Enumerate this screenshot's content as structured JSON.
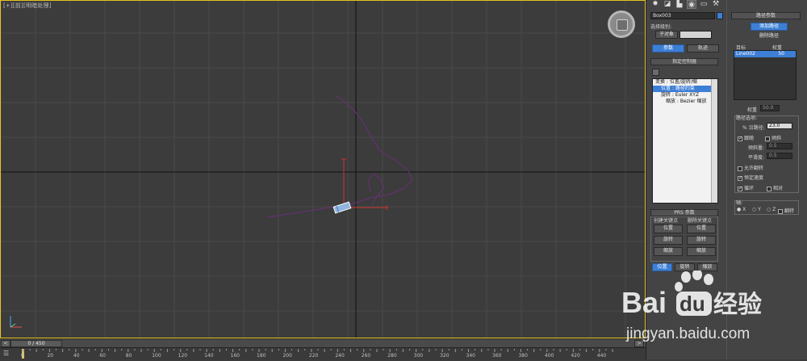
{
  "viewport": {
    "label": "[+][前][明暗处理]",
    "accent_color": "#e8c220"
  },
  "timeline": {
    "slider_text": "0 / 450",
    "prev_icon": "<",
    "next_icon": ">",
    "ruler_labels": [
      "0",
      "20",
      "40",
      "60",
      "80",
      "100",
      "120",
      "140",
      "160",
      "180",
      "200",
      "220",
      "240",
      "260",
      "280",
      "300",
      "320",
      "340",
      "360",
      "380",
      "400",
      "420",
      "440"
    ]
  },
  "left_panel": {
    "tabs": [
      "create-icon",
      "modify-icon",
      "hierarchy-icon",
      "motion-icon",
      "display-icon",
      "utilities-icon"
    ],
    "object_name": "Box003",
    "select_level_label": "选择级别:",
    "sub_object_button": "子对象",
    "params_button": "参数",
    "trajectory_button": "轨迹",
    "assign_controller_title": "指定控制器",
    "tree": [
      {
        "label": "变换 : 位置/旋转/缩",
        "selected": false
      },
      {
        "label": "位置 : 路径约束",
        "selected": true
      },
      {
        "label": "旋转 : Euler XYZ",
        "selected": false
      },
      {
        "label": "缩放 : Bezier 缩放",
        "selected": false
      }
    ],
    "prs_title": "PRS 参数",
    "create_key_label": "创建关键点",
    "delete_key_label": "删除关键点",
    "create_keys": [
      "位置",
      "旋转",
      "缩放"
    ],
    "delete_keys": [
      "位置",
      "旋转",
      "缩放"
    ],
    "bottom_tabs": [
      "位置",
      "旋转",
      "缩放"
    ]
  },
  "right_panel": {
    "path_params_title": "路径参数",
    "add_path_button": "添加路径",
    "delete_path_button": "删除路径",
    "target_label": "目标",
    "weight_label": "权重",
    "list_rows": [
      {
        "target": "Line002",
        "weight": "50"
      }
    ],
    "weight_field_label": "权重",
    "weight_field_value": "50.0",
    "path_options_label": "路径选项:",
    "percent_label": "% 沿路径:",
    "percent_value": "23.0",
    "follow_label": "跟随",
    "bank_label": "倾斜",
    "bank_amount_label": "倾斜量:",
    "bank_amount_value": "0.5",
    "smooth_label": "平滑度:",
    "smooth_value": "0.5",
    "allow_flip_label": "允许翻转",
    "constant_velocity_label": "恒定速度",
    "loop_label": "循环",
    "relative_label": "相对",
    "axis_label": "轴:",
    "axis_x": "X",
    "axis_y": "Y",
    "axis_z": "Z",
    "flip_label": "翻转"
  },
  "watermark": {
    "brand": "Bai",
    "brand2": "du",
    "brand_cn": "经验",
    "url": "jingyan.baidu.com"
  }
}
